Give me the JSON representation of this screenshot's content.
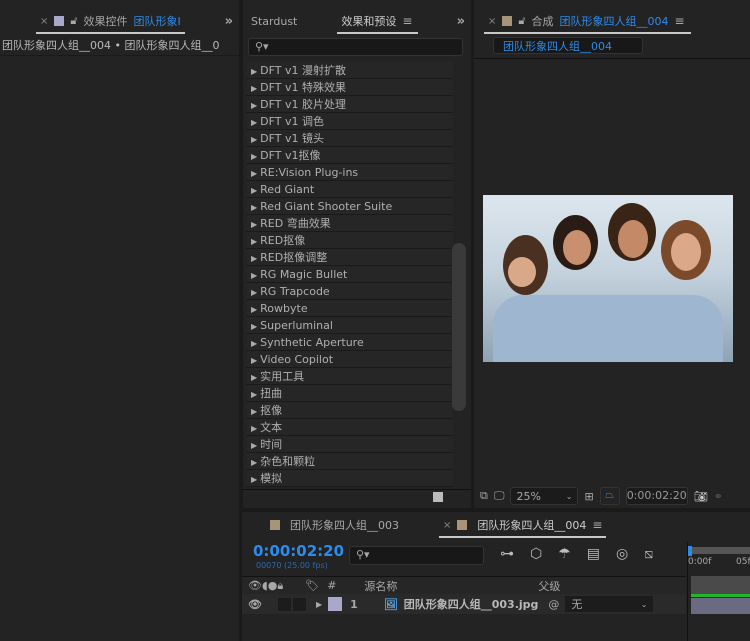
{
  "left_panel": {
    "tab_label": "效果控件",
    "tab_layer": "团队形象I",
    "breadcrumb": "团队形象四人组__004 • 团队形象四人组__0",
    "swatch": "#a9a8cc"
  },
  "effects_panel": {
    "tabs": [
      "Stardust",
      "效果和预设"
    ],
    "search_placeholder": "",
    "items": [
      "DFT v1 漫射扩散",
      "DFT v1 特殊效果",
      "DFT v1 胶片处理",
      "DFT v1 调色",
      "DFT v1 镜头",
      "DFT v1抠像",
      "RE:Vision Plug-ins",
      "Red Giant",
      "Red Giant Shooter Suite",
      "RED 弯曲效果",
      "RED抠像",
      "RED抠像调整",
      "RG Magic Bullet",
      "RG Trapcode",
      "Rowbyte",
      "Superluminal",
      "Synthetic Aperture",
      "Video Copilot",
      "实用工具",
      "扭曲",
      "抠像",
      "文本",
      "时间",
      "杂色和颗粒",
      "模拟"
    ]
  },
  "comp_panel": {
    "tab_prefix": "合成",
    "tab_name": "团队形象四人组__004",
    "sub_tab": "团队形象四人组__004",
    "zoom": "25%",
    "timecode": "0:00:02:20",
    "swatch": "#a89578"
  },
  "timeline": {
    "tabs": [
      "团队形象四人组__003",
      "团队形象四人组__004"
    ],
    "timecode": "0:00:02:20",
    "frame_info": "00070 (25.00 fps)",
    "columns": {
      "hash": "#",
      "source_name": "源名称",
      "parent": "父级"
    },
    "ruler": [
      "0:00f",
      "05f"
    ],
    "layers": [
      {
        "index": "1",
        "name": "团队形象四人组__003.jpg",
        "parent": "无",
        "color": "#a9a8cc"
      }
    ]
  },
  "colors": {
    "accent": "#2d8ceb",
    "timeline_bar": "#1fb82b"
  }
}
